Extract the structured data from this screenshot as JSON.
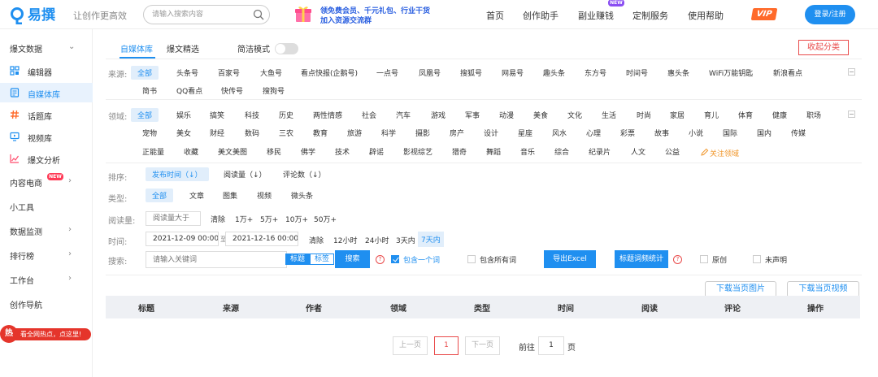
{
  "header": {
    "logo_text": "易撰",
    "slogan": "让创作更高效",
    "search_placeholder": "请输入搜索内容",
    "promo_line1": "领免费会员、千元礼包、行业干货",
    "promo_line2": "加入资源交流群",
    "nav": [
      "首页",
      "创作助手",
      "副业赚钱",
      "定制服务",
      "使用帮助"
    ],
    "new_badge": "NEW",
    "vip": "VIP",
    "login": "登录/注册",
    "colors": {
      "brand": "#1f8ff0",
      "vip": "#ff6a2a",
      "new": "#8a4ef2"
    }
  },
  "sidebar": {
    "items": [
      {
        "label": "爆文数据",
        "chevron": "⌄",
        "icon": ""
      },
      {
        "label": "编辑器",
        "icon": "grid-icon"
      },
      {
        "label": "自媒体库",
        "icon": "document-icon",
        "active": true
      },
      {
        "label": "话题库",
        "icon": "hashtag-icon"
      },
      {
        "label": "视频库",
        "icon": "monitor-icon"
      },
      {
        "label": "爆文分析",
        "icon": "line-chart-icon"
      },
      {
        "label": "内容电商",
        "chevron": "›",
        "badge": "NEW"
      },
      {
        "label": "小工具"
      },
      {
        "label": "数据监测",
        "chevron": "›"
      },
      {
        "label": "排行榜",
        "chevron": "›"
      },
      {
        "label": "工作台",
        "chevron": "›"
      },
      {
        "label": "创作导航"
      }
    ],
    "hot_icon": "热",
    "hot_text": "看全网热点，点这里!"
  },
  "main": {
    "tabs": [
      "自媒体库",
      "爆文精选"
    ],
    "simple_mode": "简洁模式",
    "collapse": "收起分类",
    "source_label": "来源:",
    "sources_row1": [
      "全部",
      "头条号",
      "百家号",
      "大鱼号",
      "看点快报(企鹅号)",
      "一点号",
      "凤凰号",
      "搜狐号",
      "网易号",
      "趣头条",
      "东方号",
      "时间号",
      "惠头条",
      "WiFi万能钥匙",
      "新浪看点"
    ],
    "sources_row2": [
      "简书",
      "QQ看点",
      "快传号",
      "搜狗号"
    ],
    "field_label": "领域:",
    "fields_row1": [
      "全部",
      "娱乐",
      "搞笑",
      "科技",
      "历史",
      "两性情感",
      "社会",
      "汽车",
      "游戏",
      "军事",
      "动漫",
      "美食",
      "文化",
      "生活",
      "时尚",
      "家居",
      "育儿",
      "体育",
      "健康",
      "职场"
    ],
    "fields_row2": [
      "宠物",
      "美女",
      "财经",
      "数码",
      "三农",
      "教育",
      "旅游",
      "科学",
      "摄影",
      "房产",
      "设计",
      "星座",
      "风水",
      "心理",
      "彩票",
      "故事",
      "小说",
      "国际",
      "国内",
      "传媒"
    ],
    "fields_row3": [
      "正能量",
      "收藏",
      "美文美图",
      "移民",
      "佛学",
      "技术",
      "辟谣",
      "影视综艺",
      "猎奇",
      "舞蹈",
      "音乐",
      "综合",
      "纪录片",
      "人文",
      "公益"
    ],
    "follow_field": "关注领域",
    "sort_label": "排序:",
    "sort_options": [
      "发布时间（↓）",
      "阅读量（↓）",
      "评论数（↓）"
    ],
    "type_label": "类型:",
    "types": [
      "全部",
      "文章",
      "图集",
      "视频",
      "微头条"
    ],
    "read_label": "阅读量:",
    "read_placeholder": "阅读量大于",
    "read_options": [
      "清除",
      "1万+",
      "5万+",
      "10万+",
      "50万+"
    ],
    "time_label": "时间:",
    "time_start": "2021-12-09 00:00",
    "time_sep": "至",
    "time_end": "2021-12-16 00:00",
    "time_options": [
      "清除",
      "12小时",
      "24小时",
      "3天内",
      "7天内"
    ],
    "search_label": "搜索:",
    "keyword_placeholder": "请输入关键词",
    "seg_title": "标题",
    "seg_tag": "标签",
    "search_btn": "搜索",
    "qmark": "?",
    "include_one": "包含一个词",
    "include_all": "包含所有词",
    "export_excel": "导出Excel",
    "title_freq": "标题词频统计",
    "original": "原创",
    "undeclared": "未声明",
    "download_images": "下载当页图片",
    "download_videos": "下载当页视频",
    "columns": [
      "标题",
      "来源",
      "作者",
      "领域",
      "类型",
      "时间",
      "阅读",
      "评论",
      "操作"
    ],
    "pager": {
      "prev": "上一页",
      "current": "1",
      "next": "下一页",
      "goto": "前往",
      "goto_value": "1",
      "page_unit": "页"
    }
  }
}
